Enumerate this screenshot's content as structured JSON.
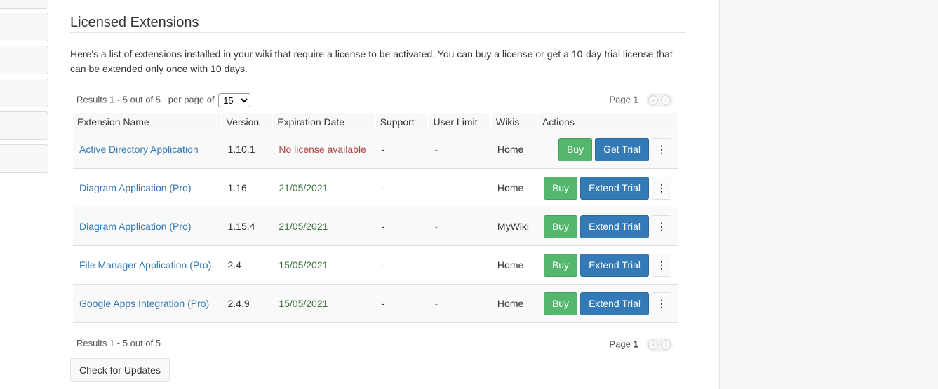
{
  "title": "Licensed Extensions",
  "intro": "Here's a list of extensions installed in your wiki that require a license to be activated. You can buy a license or get a 10-day trial license that can be extended only once with 10 days.",
  "pager_top": {
    "results": "Results 1 - 5 out of 5",
    "per_page_label": "per page of",
    "per_page_value": "15",
    "page_label": "Page",
    "page_number": "1",
    "prev_icon": "chevron-left-icon",
    "next_icon": "chevron-right-icon"
  },
  "pager_bottom": {
    "results": "Results 1 - 5 out of 5",
    "page_label": "Page",
    "page_number": "1"
  },
  "columns": [
    "Extension Name",
    "Version",
    "Expiration Date",
    "Support",
    "User Limit",
    "Wikis",
    "Actions"
  ],
  "rows": [
    {
      "name": "Active Directory Application",
      "version": "1.10.1",
      "expiration": "No license available",
      "support": "-",
      "user_limit": "-",
      "wikis": "Home",
      "buy": "Buy",
      "trial": "Get Trial"
    },
    {
      "name": "Diagram Application (Pro)",
      "version": "1.16",
      "expiration": "21/05/2021",
      "support": "-",
      "user_limit": "-",
      "wikis": "Home",
      "buy": "Buy",
      "trial": "Extend Trial"
    },
    {
      "name": "Diagram Application (Pro)",
      "version": "1.15.4",
      "expiration": "21/05/2021",
      "support": "-",
      "user_limit": "-",
      "wikis": "MyWiki",
      "buy": "Buy",
      "trial": "Extend Trial"
    },
    {
      "name": "File Manager Application (Pro)",
      "version": "2.4",
      "expiration": "15/05/2021",
      "support": "-",
      "user_limit": "-",
      "wikis": "Home",
      "buy": "Buy",
      "trial": "Extend Trial"
    },
    {
      "name": "Google Apps Integration (Pro)",
      "version": "2.4.9",
      "expiration": "15/05/2021",
      "support": "-",
      "user_limit": "-",
      "wikis": "Home",
      "buy": "Buy",
      "trial": "Extend Trial"
    }
  ],
  "more_icon": "vertical-ellipsis-icon",
  "check_updates": "Check for Updates",
  "colors": {
    "buy": "#55b76d",
    "trial": "#337ab7",
    "no_license": "#a94442",
    "valid_date": "#3c763d",
    "link": "#337ab7"
  }
}
